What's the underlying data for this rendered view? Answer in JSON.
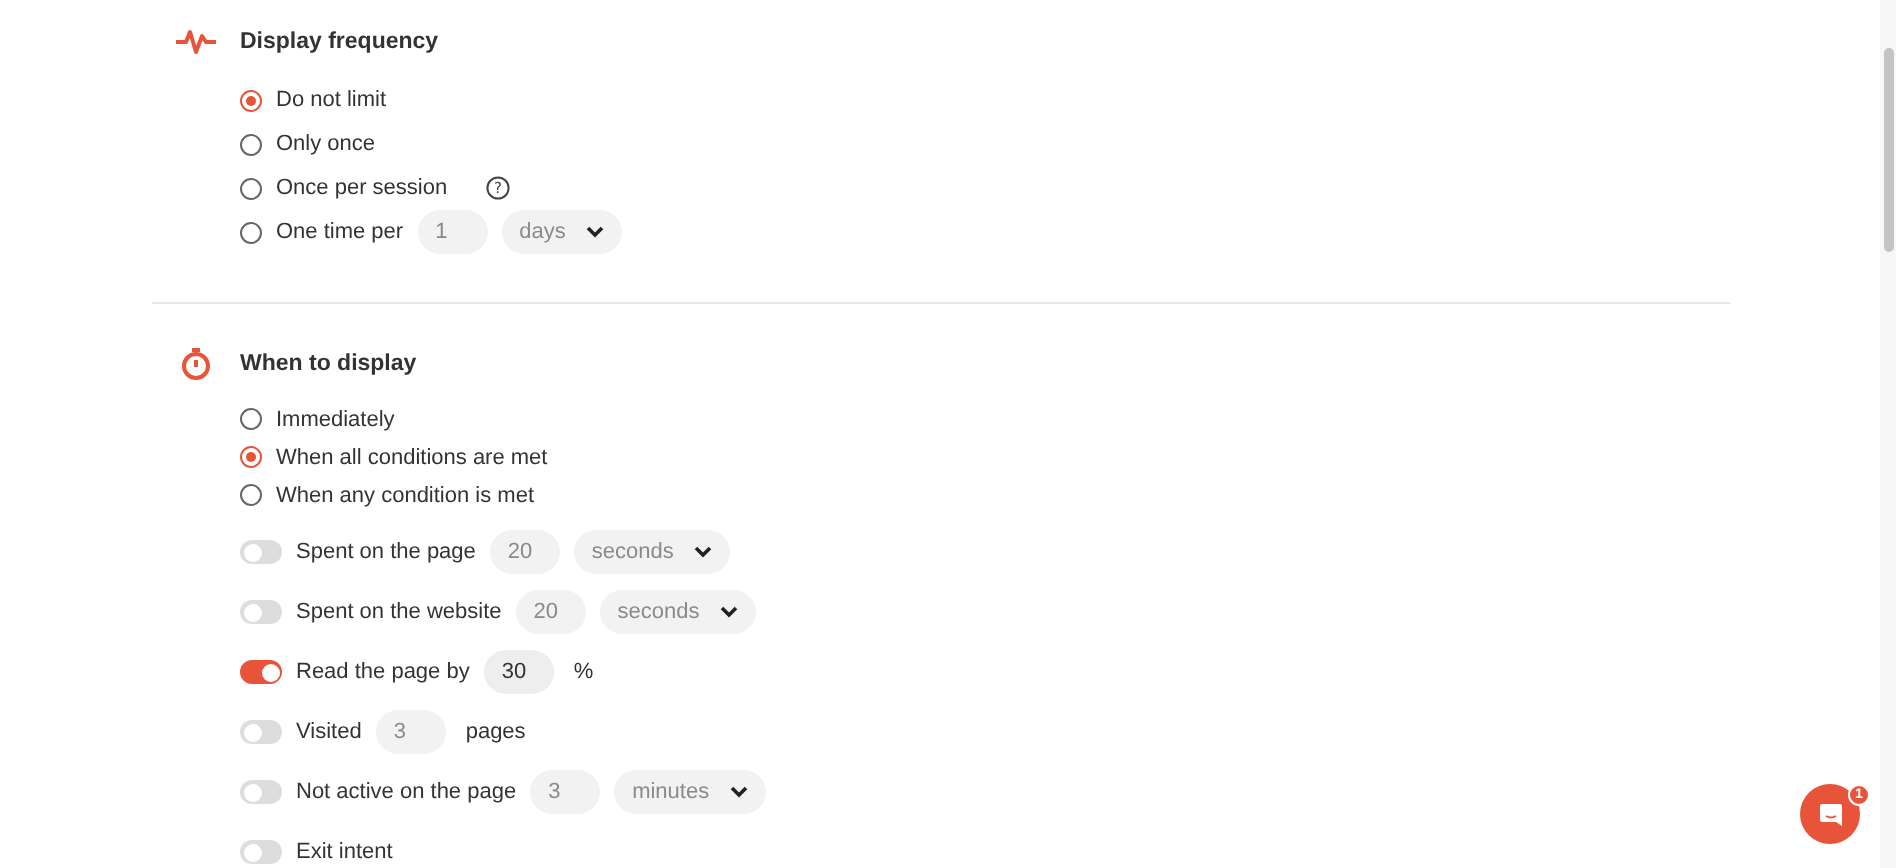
{
  "display_frequency": {
    "title": "Display frequency",
    "options": [
      {
        "label": "Do not limit",
        "selected": true
      },
      {
        "label": "Only once",
        "selected": false
      },
      {
        "label": "Once per session",
        "selected": false,
        "help": "?"
      },
      {
        "label": "One time per",
        "selected": false,
        "number": {
          "value": "1",
          "disabled": true
        },
        "unit": {
          "value": "days",
          "disabled": true
        }
      }
    ]
  },
  "when_to_display": {
    "title": "When to display",
    "options": [
      {
        "label": "Immediately",
        "selected": false
      },
      {
        "label": "When all conditions are met",
        "selected": true
      },
      {
        "label": "When any condition is met",
        "selected": false
      }
    ],
    "conditions": [
      {
        "label": "Spent on the page",
        "on": false,
        "number": {
          "value": "20",
          "disabled": true
        },
        "unit": {
          "value": "seconds",
          "disabled": true
        }
      },
      {
        "label": "Spent on the website",
        "on": false,
        "number": {
          "value": "20",
          "disabled": true
        },
        "unit": {
          "value": "seconds",
          "disabled": true
        }
      },
      {
        "label": "Read the page by",
        "on": true,
        "number": {
          "value": "30",
          "disabled": false
        },
        "suffix": "%"
      },
      {
        "label": "Visited",
        "on": false,
        "number": {
          "value": "3",
          "disabled": true
        },
        "suffix": "pages"
      },
      {
        "label": "Not active on the page",
        "on": false,
        "number": {
          "value": "3",
          "disabled": true
        },
        "unit": {
          "value": "minutes",
          "disabled": true
        }
      },
      {
        "label": "Exit intent",
        "on": false
      }
    ]
  },
  "chat": {
    "badge": "1"
  }
}
